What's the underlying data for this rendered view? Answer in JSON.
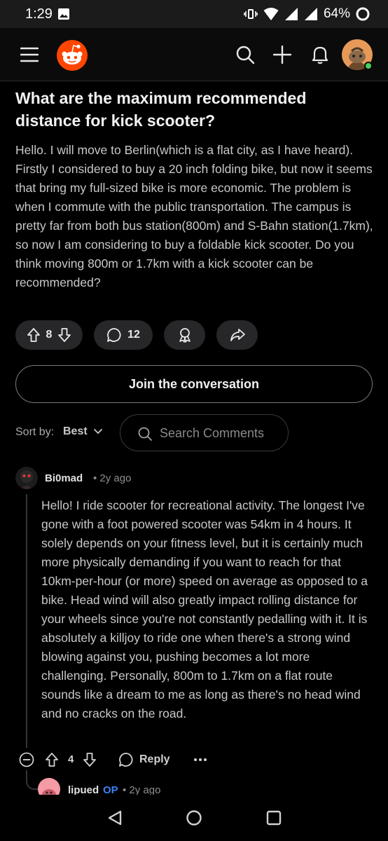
{
  "status_bar": {
    "time": "1:29",
    "battery": "64%"
  },
  "post": {
    "title": "What are the maximum recommended distance for kick scooter?",
    "body": "Hello. I will move to Berlin(which is a flat city, as I have heard). Firstly I considered to buy a 20 inch folding bike, but now it seems that bring my full-sized bike is more economic. The problem is when I commute with the public transportation. The campus is pretty far from both bus station(800m) and S-Bahn station(1.7km), so now I am considering to buy a foldable kick scooter. Do you think moving 800m or 1.7km with a kick scooter can be recommended?",
    "votes": "8",
    "comments": "12"
  },
  "join_label": "Join the conversation",
  "sort": {
    "label": "Sort by:",
    "value": "Best"
  },
  "search": {
    "placeholder": "Search Comments"
  },
  "comment": {
    "author": "Bi0mad",
    "time": "• 2y ago",
    "body": "Hello! I ride scooter for recreational activity. The longest I've gone with a foot powered scooter was 54km in 4 hours. It solely depends on your fitness level, but it is certainly much more physically demanding if you want to reach for that 10km-per-hour (or more) speed on average as opposed to a bike. Head wind will also greatly impact rolling distance for your wheels since you're not constantly pedalling with it. It is absolutely a killjoy to ride one when there's a strong wind blowing against you, pushing becomes a lot more challenging. Personally, 800m to 1.7km on a flat route sounds like a dream to me as long as there's no head wind and no cracks on the road.",
    "votes": "4",
    "reply_label": "Reply",
    "more": "···"
  },
  "reply": {
    "author": "lipued",
    "badge": "OP",
    "time": "• 2y ago"
  },
  "colors": {
    "background": "#000000",
    "reddit_orange": "#ff4500",
    "op_blue": "#3b82f6",
    "online_green": "#46d160"
  },
  "icons": [
    "image-icon",
    "vibrate-icon",
    "wifi-icon",
    "signal-icon",
    "battery-icon",
    "menu-icon",
    "reddit-logo",
    "search-icon",
    "plus-icon",
    "bell-icon",
    "upvote-icon",
    "downvote-icon",
    "comment-icon",
    "award-icon",
    "share-icon",
    "chevron-down-icon",
    "collapse-icon",
    "more-icon",
    "back-icon",
    "home-icon",
    "recents-icon"
  ]
}
